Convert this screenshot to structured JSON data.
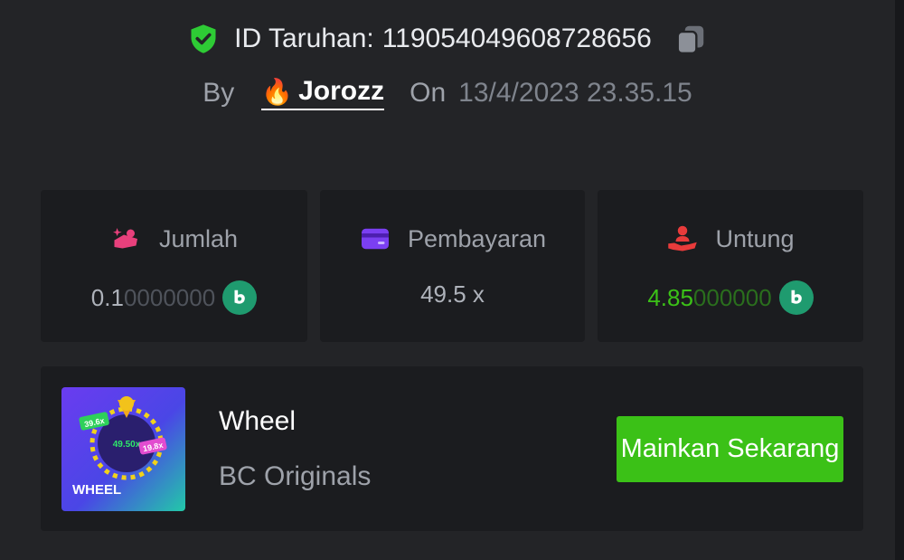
{
  "bet": {
    "id_label": "ID Taruhan:",
    "id_value": "119054049608728656"
  },
  "meta": {
    "by_label": "By",
    "username": "Jorozz",
    "user_emoji": "🔥",
    "on_label": "On",
    "date": "13/4/2023 23.35.15"
  },
  "stats": {
    "amount": {
      "label": "Jumlah",
      "value_lead": "0.1",
      "value_dim": "0000000",
      "icon": "money-hand-icon"
    },
    "payout": {
      "label": "Pembayaran",
      "value": "49.5 x",
      "icon": "card-icon"
    },
    "profit": {
      "label": "Untung",
      "value_lead": "4.85",
      "value_dim": "000000",
      "icon": "profit-hand-icon"
    }
  },
  "game": {
    "name": "Wheel",
    "provider": "BC Originals",
    "thumb_title": "WHEEL",
    "thumb_center": "49.50x",
    "thumb_left_tag": "39.6x",
    "thumb_right_tag": "19.8x",
    "play_button": "Mainkan Sekarang"
  },
  "colors": {
    "accent_green": "#3bc117",
    "shield_green": "#2ecb35",
    "coin_green": "#1f9b6f",
    "amount_pink": "#e8407c",
    "payout_purple": "#7b3ff2",
    "profit_red": "#e83b3b"
  }
}
